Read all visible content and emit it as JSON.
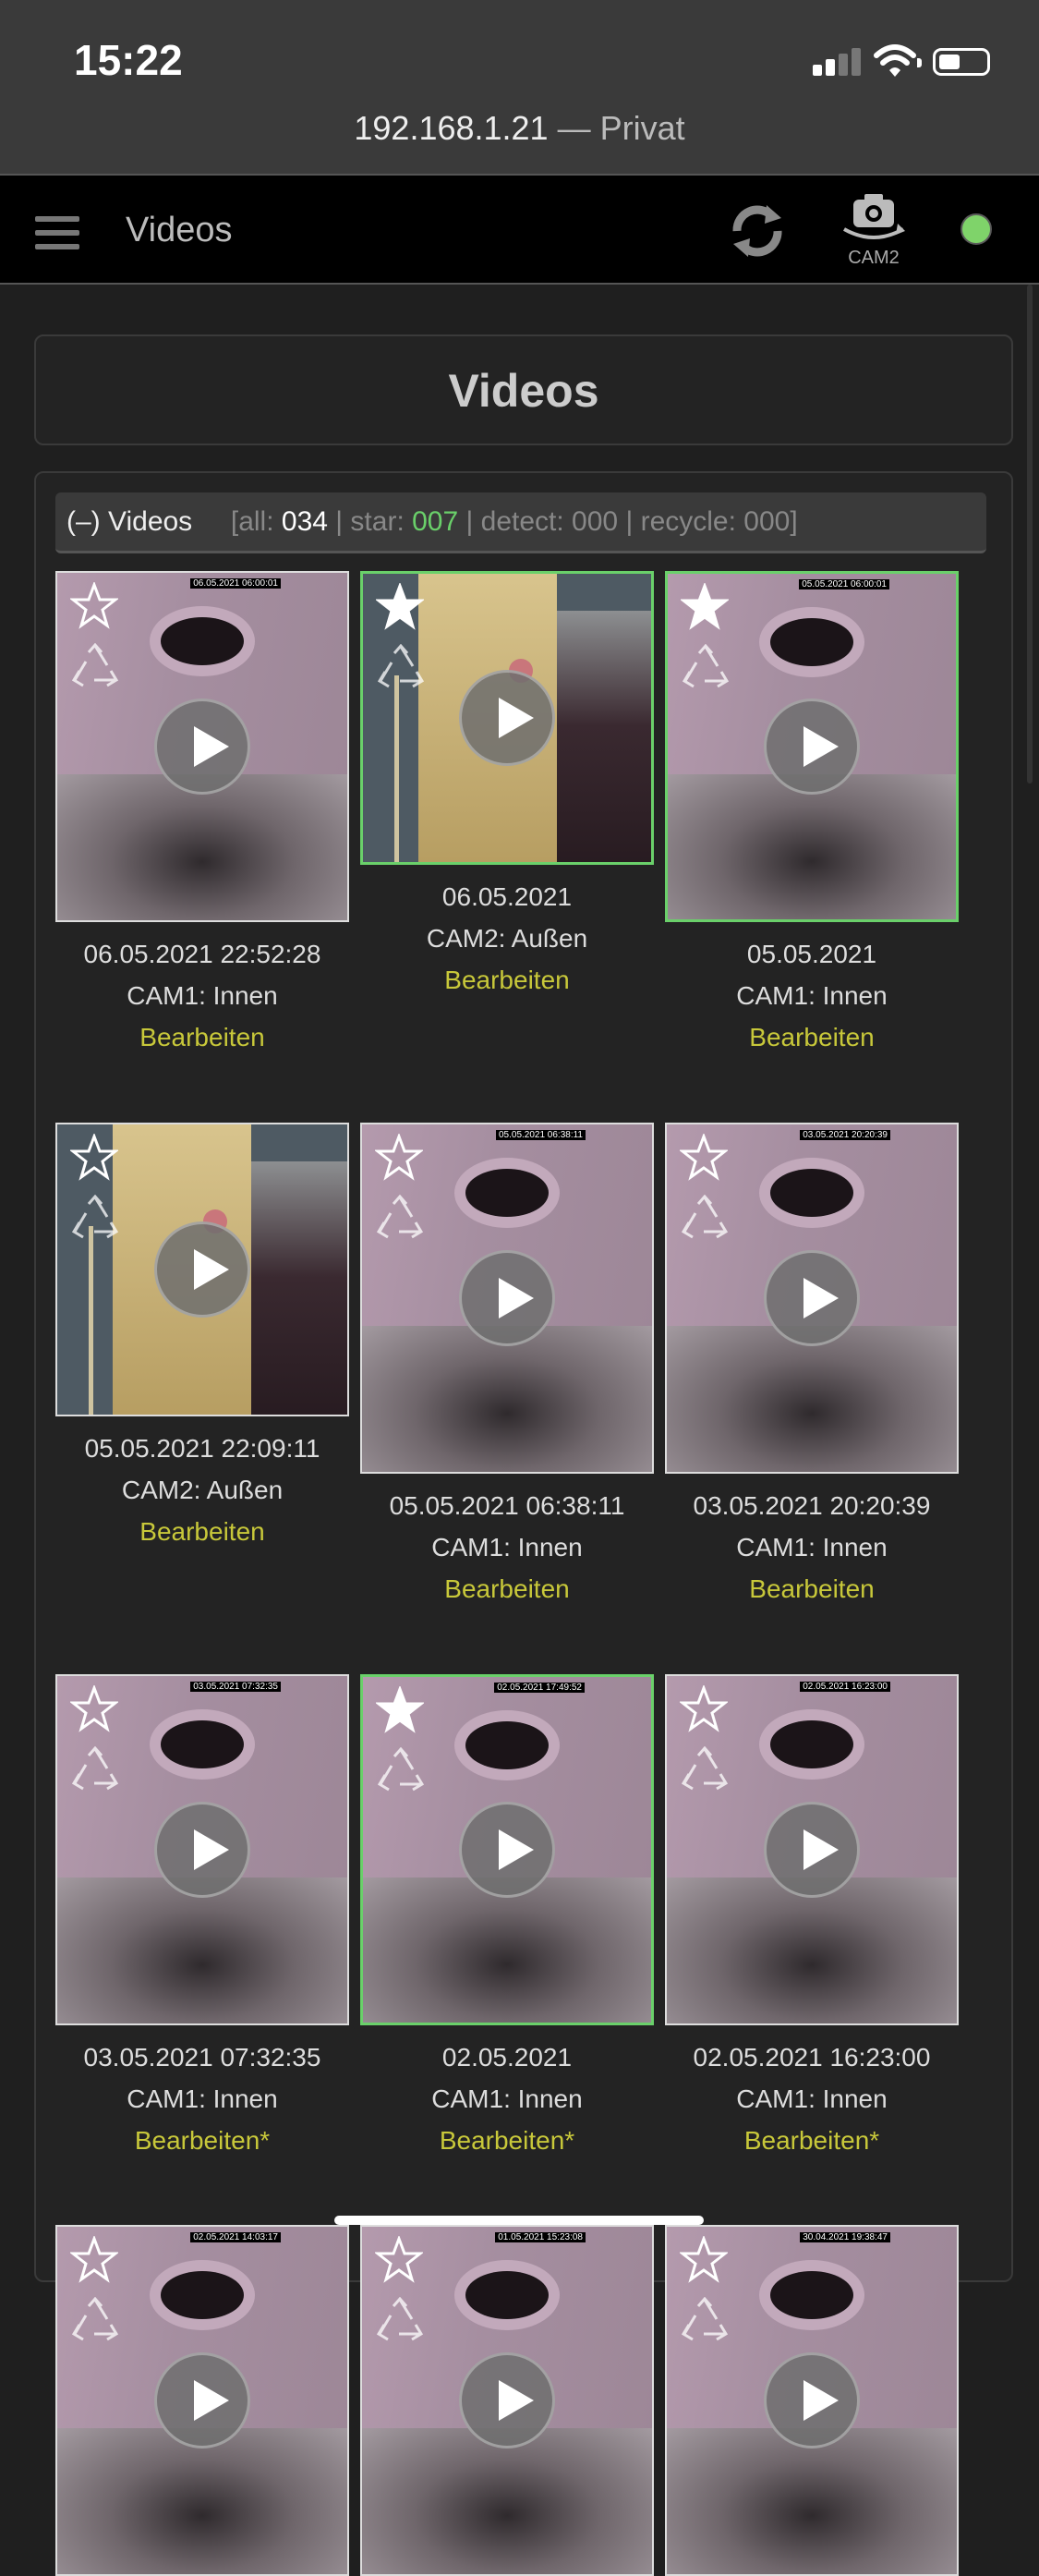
{
  "status_bar": {
    "time": "15:22",
    "url_host": "192.168.1.21",
    "url_sep": " — ",
    "url_label": "Privat"
  },
  "nav": {
    "title": "Videos",
    "cam_label": "CAM2",
    "status_color": "#7fd36a"
  },
  "page_header": "Videos",
  "filter": {
    "label": "(–) Videos",
    "all_label": "[all: ",
    "all": "034",
    "star_label": " | star: ",
    "star": "007",
    "detect_label": " | detect: ",
    "detect": "000",
    "recycle_label": " | recycle: ",
    "recycle": "000",
    "end": "]"
  },
  "videos": [
    {
      "date": "06.05.2021 22:52:28",
      "camera": "CAM1: Innen",
      "edit": "Bearbeiten",
      "starred": false,
      "type": "inside",
      "stamp": "06.05.2021 06:00:01"
    },
    {
      "date": "06.05.2021",
      "camera": "CAM2: Außen",
      "edit": "Bearbeiten",
      "starred": true,
      "type": "outside"
    },
    {
      "date": "05.05.2021",
      "camera": "CAM1: Innen",
      "edit": "Bearbeiten",
      "starred": true,
      "type": "inside",
      "stamp": "05.05.2021 06:00:01"
    },
    {
      "date": "05.05.2021 22:09:11",
      "camera": "CAM2: Außen",
      "edit": "Bearbeiten",
      "starred": false,
      "type": "outside"
    },
    {
      "date": "05.05.2021 06:38:11",
      "camera": "CAM1: Innen",
      "edit": "Bearbeiten",
      "starred": false,
      "type": "inside",
      "stamp": "05.05.2021 06:38:11"
    },
    {
      "date": "03.05.2021 20:20:39",
      "camera": "CAM1: Innen",
      "edit": "Bearbeiten",
      "starred": false,
      "type": "inside",
      "stamp": "03.05.2021 20:20:39"
    },
    {
      "date": "03.05.2021 07:32:35",
      "camera": "CAM1: Innen",
      "edit": "Bearbeiten*",
      "starred": false,
      "type": "inside",
      "stamp": "03.05.2021 07:32:35"
    },
    {
      "date": "02.05.2021",
      "camera": "CAM1: Innen",
      "edit": "Bearbeiten*",
      "starred": true,
      "type": "inside",
      "stamp": "02.05.2021 17:49:52"
    },
    {
      "date": "02.05.2021 16:23:00",
      "camera": "CAM1: Innen",
      "edit": "Bearbeiten*",
      "starred": false,
      "type": "inside",
      "stamp": "02.05.2021 16:23:00"
    },
    {
      "date": "",
      "camera": "",
      "edit": "",
      "starred": false,
      "type": "inside",
      "stamp": "02.05.2021 14:03:17"
    },
    {
      "date": "",
      "camera": "",
      "edit": "",
      "starred": false,
      "type": "inside",
      "stamp": "01.05.2021 15:23:08"
    },
    {
      "date": "",
      "camera": "",
      "edit": "",
      "starred": false,
      "type": "inside",
      "stamp": "30.04.2021 19:38:47"
    }
  ]
}
